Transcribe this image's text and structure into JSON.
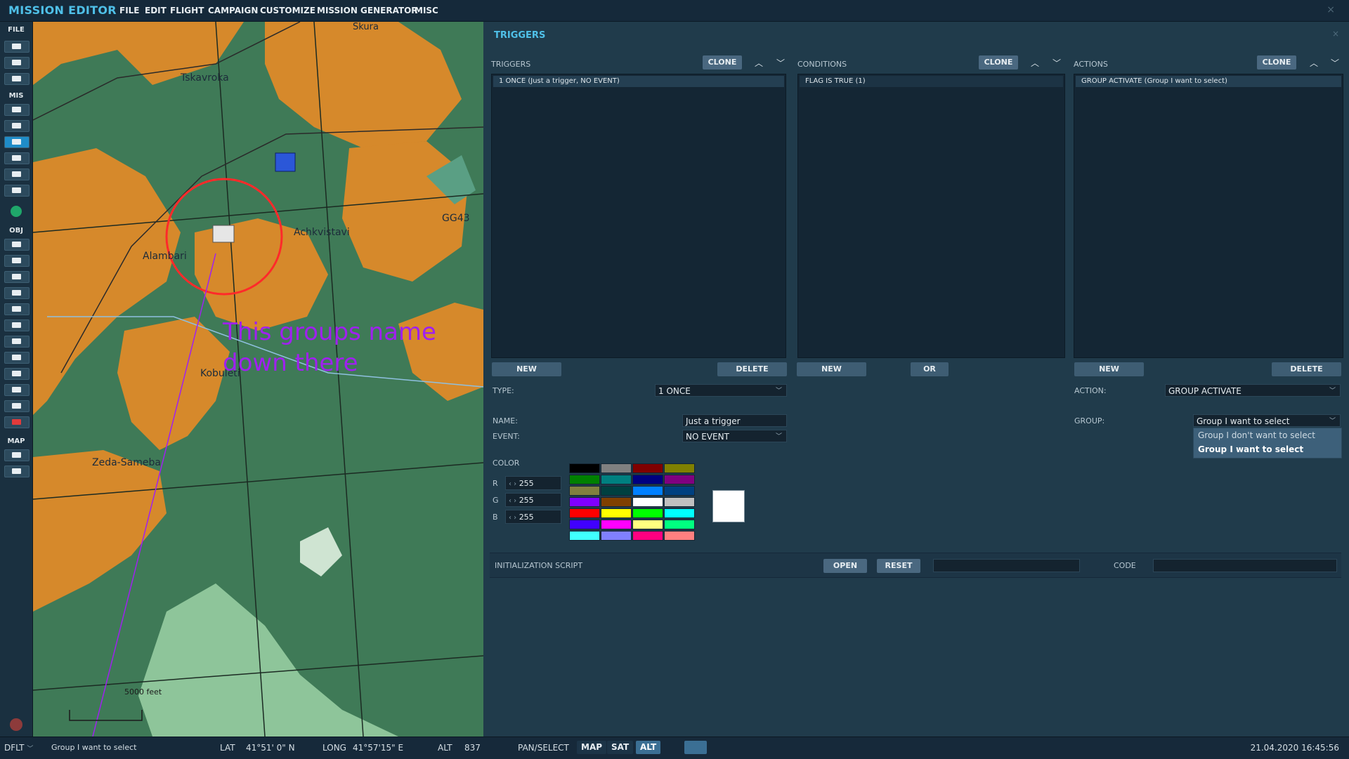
{
  "app": {
    "title": "MISSION EDITOR",
    "menu": [
      "FILE",
      "EDIT",
      "FLIGHT",
      "CAMPAIGN",
      "CUSTOMIZE",
      "MISSION GENERATOR",
      "MISC"
    ],
    "close_glyph": "×"
  },
  "toolbar": {
    "file_label": "FILE",
    "mis_label": "MIS",
    "obj_label": "OBJ",
    "map_label": "MAP",
    "file_icons": [
      "new-file-icon",
      "open-folder-icon",
      "save-icon"
    ],
    "mis_icons": [
      "briefing-icon",
      "weather-icon",
      "trigger-zone-icon",
      "mission-goals-icon",
      "triggers-icon",
      "check-icon",
      "unit-icon"
    ],
    "obj_icons": [
      "airplane-icon",
      "helicopter-icon",
      "ship-icon",
      "vehicle-icon",
      "static-icon",
      "navpoint-icon",
      "target-icon",
      "trigger-zone-circle-icon",
      "naval-icon",
      "template-icon",
      "shapes-icon",
      "delete-icon"
    ],
    "map_icons": [
      "map-options-icon",
      "ruler-icon"
    ]
  },
  "map": {
    "places": [
      {
        "name": "Skura"
      },
      {
        "name": "Tskavroka"
      },
      {
        "name": "Achkvistavi"
      },
      {
        "name": "Alambari"
      },
      {
        "name": "Kobuleti"
      },
      {
        "name": "Zeda-Sameba"
      },
      {
        "name": "GG43"
      }
    ],
    "annotation": "This groups name\ndown there",
    "scale_label": "5000 feet",
    "colors": {
      "forest": "#3f7a57",
      "urban": "#d6892b",
      "sea": "#5a9f84",
      "zone": "#ff2a2a",
      "annotation": "#a020f0"
    }
  },
  "panel": {
    "title": "TRIGGERS",
    "close_glyph": "×",
    "triggers": {
      "label": "TRIGGERS",
      "clone": "CLONE",
      "items": [
        "1 ONCE (Just a trigger, NO EVENT)"
      ],
      "new": "NEW",
      "delete": "DELETE",
      "type_label": "TYPE:",
      "type_value": "1 ONCE",
      "name_label": "NAME:",
      "name_value": "Just a trigger",
      "event_label": "EVENT:",
      "event_value": "NO EVENT",
      "color_label": "COLOR",
      "r_label": "R",
      "r_value": "255",
      "g_label": "G",
      "g_value": "255",
      "b_label": "B",
      "b_value": "255",
      "palette": [
        "#000000",
        "#808080",
        "#800000",
        "#808000",
        "#008000",
        "#008080",
        "#000080",
        "#800080",
        "#808040",
        "#004040",
        "#0080ff",
        "#004080",
        "#8000ff",
        "#804000",
        "#ffffff",
        "#c0c0c0",
        "#ff0000",
        "#ffff00",
        "#00ff00",
        "#00ffff",
        "#4000ff",
        "#ff00ff",
        "#ffff80",
        "#00ff80",
        "#40ffff",
        "#8080ff",
        "#ff0080",
        "#ff8080"
      ],
      "preview_color": "#ffffff"
    },
    "conditions": {
      "label": "CONDITIONS",
      "clone": "CLONE",
      "items": [
        "FLAG IS TRUE (1)"
      ],
      "new": "NEW",
      "or": "OR"
    },
    "actions": {
      "label": "ACTIONS",
      "clone": "CLONE",
      "items": [
        "GROUP ACTIVATE (Group I want to select)"
      ],
      "new": "NEW",
      "delete": "DELETE",
      "action_label": "ACTION:",
      "action_value": "GROUP ACTIVATE",
      "group_label": "GROUP:",
      "group_value": "Group I want to select",
      "group_options": [
        "Group I don't want to select",
        "Group I want to select"
      ]
    },
    "init_script": {
      "label": "INITIALIZATION SCRIPT",
      "open": "OPEN",
      "reset": "RESET",
      "code_label": "CODE"
    }
  },
  "status": {
    "mode": "DFLT",
    "selection": "Group I want to select",
    "lat_label": "LAT",
    "lat_value": "41°51' 0\" N",
    "long_label": "LONG",
    "long_value": "41°57'15\" E",
    "alt_label": "ALT",
    "alt_value": "837",
    "pan_select": "PAN/SELECT",
    "map_btn": "MAP",
    "sat_btn": "SAT",
    "alt_btn": "ALT",
    "datetime": "21.04.2020 16:45:56"
  }
}
